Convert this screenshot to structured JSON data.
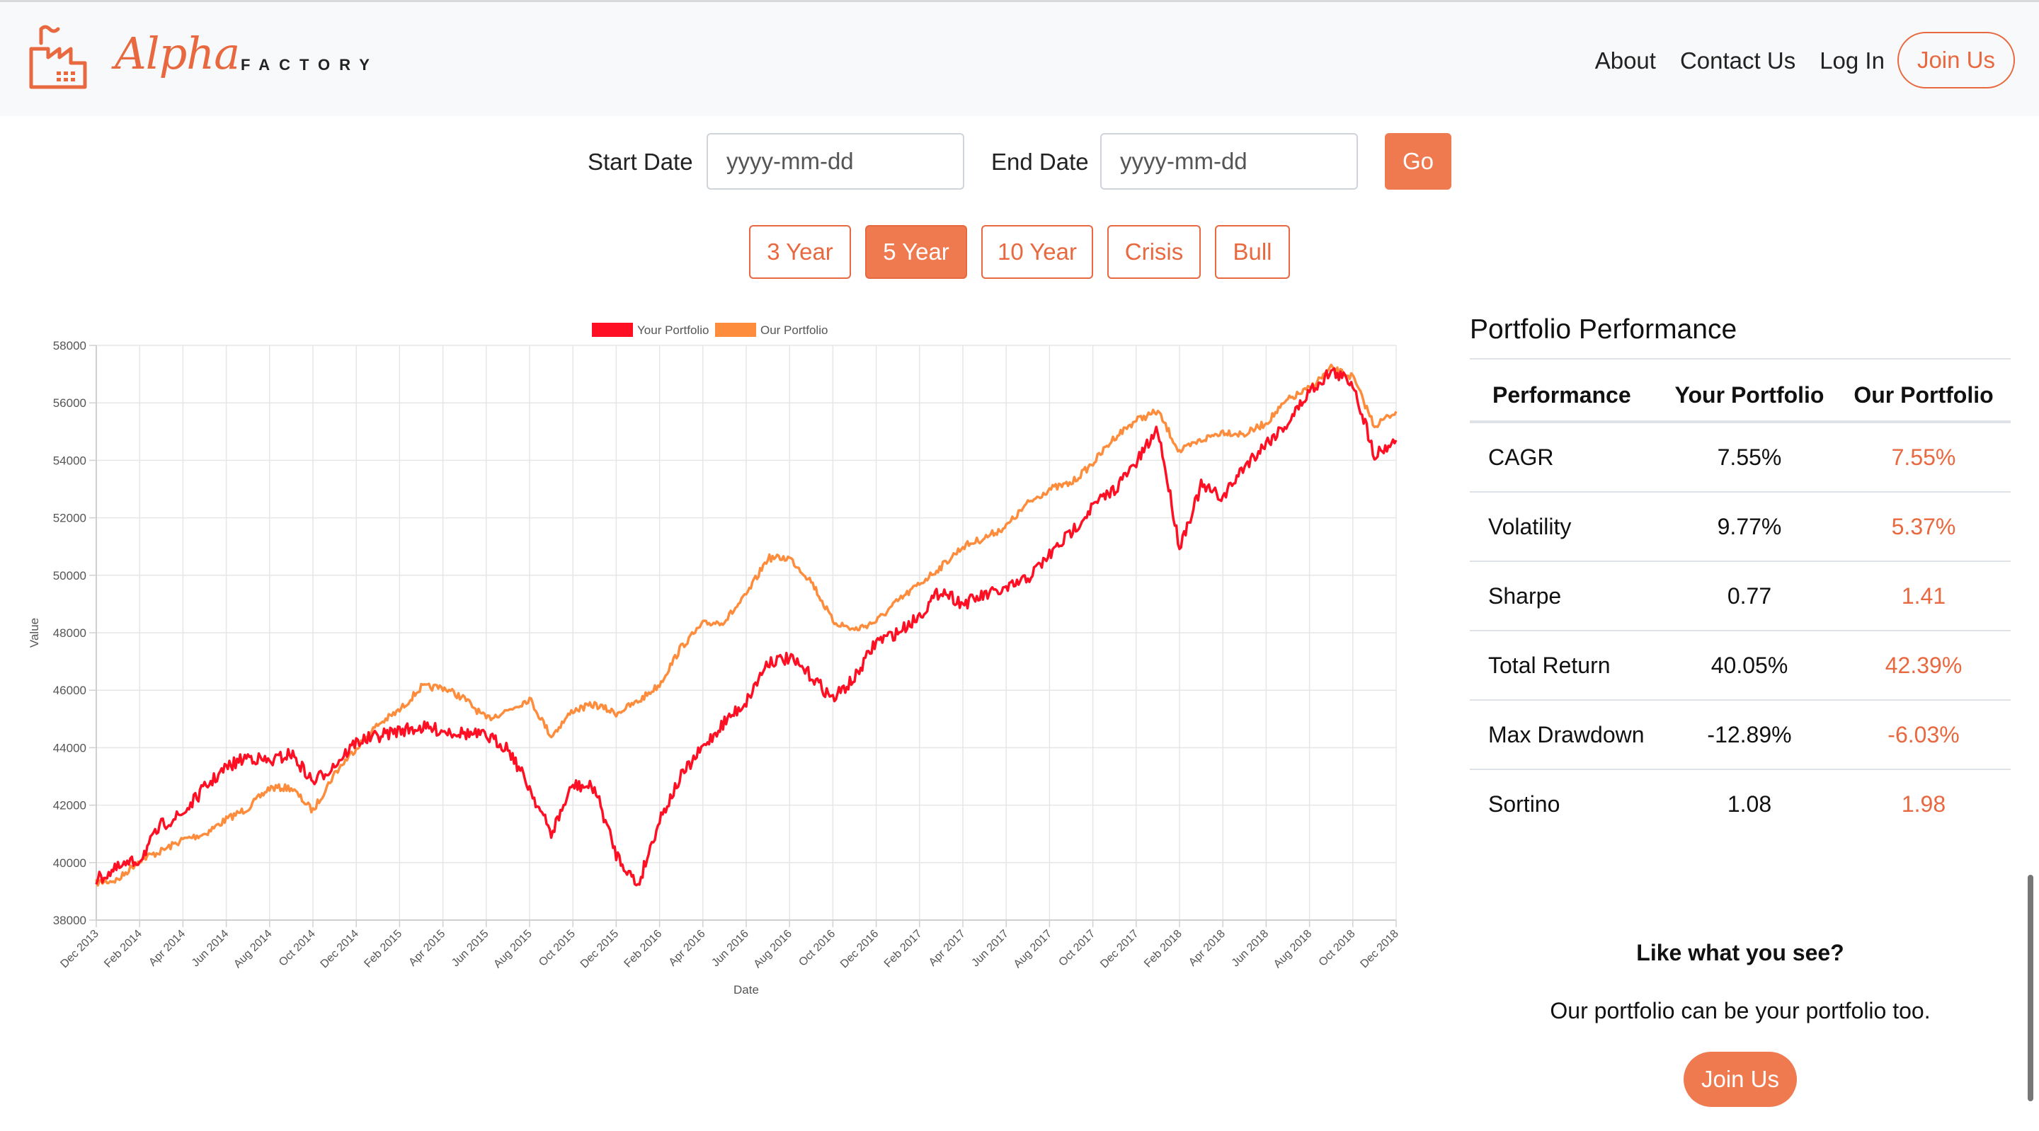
{
  "brand": {
    "name_script": "Alpha",
    "name_caps": "FACTORY",
    "accent": "#e8683f"
  },
  "nav": {
    "about": "About",
    "contact": "Contact Us",
    "login": "Log In",
    "join": "Join Us"
  },
  "date_filter": {
    "start_label": "Start Date",
    "start_placeholder": "yyyy-mm-dd",
    "end_label": "End Date",
    "end_placeholder": "yyyy-mm-dd",
    "go": "Go"
  },
  "periods": [
    {
      "label": "3 Year",
      "active": false
    },
    {
      "label": "5 Year",
      "active": true
    },
    {
      "label": "10 Year",
      "active": false
    },
    {
      "label": "Crisis",
      "active": false
    },
    {
      "label": "Bull",
      "active": false
    }
  ],
  "chart_data": {
    "type": "line",
    "xlabel": "Date",
    "ylabel": "Value",
    "ylim": [
      38000,
      58000
    ],
    "yticks": [
      38000,
      40000,
      42000,
      44000,
      46000,
      48000,
      50000,
      52000,
      54000,
      56000,
      58000
    ],
    "xticks": [
      "Dec 2013",
      "Feb 2014",
      "Apr 2014",
      "Jun 2014",
      "Aug 2014",
      "Oct 2014",
      "Dec 2014",
      "Feb 2015",
      "Apr 2015",
      "Jun 2015",
      "Aug 2015",
      "Oct 2015",
      "Dec 2015",
      "Feb 2016",
      "Apr 2016",
      "Jun 2016",
      "Aug 2016",
      "Oct 2016",
      "Dec 2016",
      "Feb 2017",
      "Apr 2017",
      "Jun 2017",
      "Aug 2017",
      "Oct 2017",
      "Dec 2017",
      "Feb 2018",
      "Apr 2018",
      "Jun 2018",
      "Aug 2018",
      "Oct 2018",
      "Dec 2018"
    ],
    "legend_position": "top-center",
    "grid": true,
    "x": [
      "2013-12",
      "2014-01",
      "2014-02",
      "2014-03",
      "2014-04",
      "2014-05",
      "2014-06",
      "2014-07",
      "2014-08",
      "2014-09",
      "2014-10",
      "2014-11",
      "2014-12",
      "2015-01",
      "2015-02",
      "2015-03",
      "2015-04",
      "2015-05",
      "2015-06",
      "2015-07",
      "2015-08",
      "2015-09",
      "2015-10",
      "2015-11",
      "2015-12",
      "2016-01",
      "2016-02",
      "2016-03",
      "2016-04",
      "2016-05",
      "2016-06",
      "2016-07",
      "2016-08",
      "2016-09",
      "2016-10",
      "2016-11",
      "2016-12",
      "2017-01",
      "2017-02",
      "2017-03",
      "2017-04",
      "2017-05",
      "2017-06",
      "2017-07",
      "2017-08",
      "2017-09",
      "2017-10",
      "2017-11",
      "2017-12",
      "2018-01",
      "2018-02",
      "2018-03",
      "2018-04",
      "2018-05",
      "2018-06",
      "2018-07",
      "2018-08",
      "2018-09",
      "2018-10",
      "2018-11",
      "2018-12"
    ],
    "series": [
      {
        "name": "Your Portfolio",
        "color": "#ff0f23",
        "values": [
          39400,
          39800,
          40100,
          41300,
          41700,
          42600,
          43300,
          43700,
          43500,
          43800,
          42800,
          43400,
          44200,
          44400,
          44600,
          44700,
          44600,
          44500,
          44400,
          44000,
          42600,
          41000,
          42700,
          42600,
          40300,
          39200,
          41500,
          43000,
          44000,
          44900,
          45600,
          47000,
          47100,
          46500,
          45700,
          46400,
          47700,
          48000,
          48600,
          49500,
          49000,
          49300,
          49500,
          49900,
          50700,
          51500,
          52400,
          53000,
          53900,
          55100,
          51000,
          53100,
          52700,
          53800,
          54600,
          55300,
          56400,
          57100,
          56700,
          54200,
          54700
        ]
      },
      {
        "name": "Our Portfolio",
        "color": "#fd8d3c",
        "values": [
          39300,
          39400,
          40100,
          40400,
          40800,
          41000,
          41500,
          41900,
          42600,
          42600,
          41800,
          43100,
          44000,
          44800,
          45300,
          46100,
          46100,
          45700,
          45000,
          45300,
          45700,
          44400,
          45300,
          45500,
          45200,
          45600,
          46200,
          47500,
          48300,
          48400,
          49300,
          50600,
          50600,
          49800,
          48400,
          48100,
          48400,
          49100,
          49700,
          50300,
          51000,
          51300,
          51700,
          52500,
          53000,
          53200,
          53900,
          54800,
          55400,
          55700,
          54300,
          54700,
          55000,
          54900,
          55300,
          56100,
          56500,
          57200,
          56900,
          55200,
          55700
        ]
      }
    ]
  },
  "performance": {
    "title": "Portfolio Performance",
    "headers": [
      "Performance",
      "Your Portfolio",
      "Our Portfolio"
    ],
    "rows": [
      {
        "metric": "CAGR",
        "yours": "7.55%",
        "ours": "7.55%"
      },
      {
        "metric": "Volatility",
        "yours": "9.77%",
        "ours": "5.37%"
      },
      {
        "metric": "Sharpe",
        "yours": "0.77",
        "ours": "1.41"
      },
      {
        "metric": "Total Return",
        "yours": "40.05%",
        "ours": "42.39%"
      },
      {
        "metric": "Max Drawdown",
        "yours": "-12.89%",
        "ours": "-6.03%"
      },
      {
        "metric": "Sortino",
        "yours": "1.08",
        "ours": "1.98"
      }
    ]
  },
  "cta": {
    "heading": "Like what you see?",
    "text": "Our portfolio can be your portfolio too.",
    "button": "Join Us"
  }
}
